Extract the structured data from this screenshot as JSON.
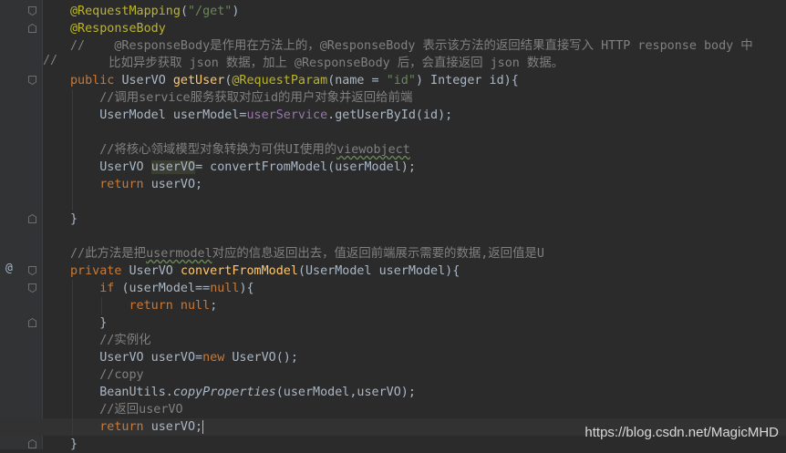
{
  "editor": {
    "lines": [
      {
        "tokens": [
          [
            "ann",
            "@RequestMapping"
          ],
          [
            "plain",
            "("
          ],
          [
            "str",
            "\"/get\""
          ],
          [
            "plain",
            ")"
          ]
        ]
      },
      {
        "tokens": [
          [
            "ann",
            "@ResponseBody"
          ]
        ]
      },
      {
        "tokens": [
          [
            "com",
            "//    @ResponseBody是作用在方法上的，@ResponseBody 表示该方法的返回结果直接写入 HTTP response body 中"
          ]
        ]
      },
      {
        "tokens": [
          [
            "com",
            "   比如异步获取 json 数据，加上 @ResponseBody 后，会直接返回 json 数据。"
          ]
        ]
      },
      {
        "tokens": [
          [
            "kw",
            "public "
          ],
          [
            "plain",
            "UserVO "
          ],
          [
            "fn",
            "getUser"
          ],
          [
            "plain",
            "("
          ],
          [
            "ann",
            "@RequestParam"
          ],
          [
            "plain",
            "(name = "
          ],
          [
            "str",
            "\"id\""
          ],
          [
            "plain",
            ") Integer id){"
          ]
        ]
      },
      {
        "tokens": [
          [
            "com",
            "    //调用service服务获取对应id的用户对象并返回给前端"
          ]
        ]
      },
      {
        "tokens": [
          [
            "plain",
            "    UserModel userModel="
          ],
          [
            "fld",
            "userService"
          ],
          [
            "plain",
            ".getUserById(id);"
          ]
        ]
      },
      {
        "tokens": [
          [
            "plain",
            ""
          ]
        ]
      },
      {
        "tokens": [
          [
            "com",
            "    //将核心领域模型对象转换为可供UI使用的"
          ],
          [
            "com squiggle",
            "viewobject"
          ]
        ]
      },
      {
        "tokens": [
          [
            "plain",
            "    UserVO "
          ],
          [
            "plain hl-var",
            "userVO"
          ],
          [
            "plain",
            "= convertFromModel(userModel);"
          ]
        ]
      },
      {
        "tokens": [
          [
            "kw",
            "    return "
          ],
          [
            "plain",
            "userVO;"
          ]
        ]
      },
      {
        "tokens": [
          [
            "plain",
            ""
          ]
        ]
      },
      {
        "tokens": [
          [
            "plain",
            "}"
          ]
        ]
      },
      {
        "tokens": [
          [
            "plain",
            ""
          ]
        ]
      },
      {
        "tokens": [
          [
            "com",
            "//此方法是把"
          ],
          [
            "com squiggle",
            "usermodel"
          ],
          [
            "com",
            "对应的信息返回出去，值返回前端展示需要的数据,返回值是U"
          ]
        ]
      },
      {
        "tokens": [
          [
            "kw",
            "private "
          ],
          [
            "plain",
            "UserVO "
          ],
          [
            "fn",
            "convertFromModel"
          ],
          [
            "plain",
            "(UserModel userModel){"
          ]
        ]
      },
      {
        "tokens": [
          [
            "kw",
            "    if "
          ],
          [
            "plain",
            "(userModel=="
          ],
          [
            "kw",
            "null"
          ],
          [
            "plain",
            "){"
          ]
        ]
      },
      {
        "tokens": [
          [
            "kw",
            "        return null"
          ],
          [
            "plain",
            ";"
          ]
        ]
      },
      {
        "tokens": [
          [
            "plain",
            "    }"
          ]
        ]
      },
      {
        "tokens": [
          [
            "com",
            "    //实例化"
          ]
        ]
      },
      {
        "tokens": [
          [
            "plain",
            "    UserVO userVO="
          ],
          [
            "kw",
            "new "
          ],
          [
            "plain",
            "UserVO();"
          ]
        ]
      },
      {
        "tokens": [
          [
            "com",
            "    //copy"
          ]
        ]
      },
      {
        "tokens": [
          [
            "plain",
            "    BeanUtils."
          ],
          [
            "plain ital",
            "copyProperties"
          ],
          [
            "plain",
            "(userModel,userVO);"
          ]
        ]
      },
      {
        "tokens": [
          [
            "com",
            "    //返回userVO"
          ]
        ]
      },
      {
        "tokens": [
          [
            "kw",
            "    return "
          ],
          [
            "plain",
            "userVO;"
          ]
        ]
      },
      {
        "tokens": [
          [
            "plain",
            "}"
          ]
        ]
      }
    ],
    "gutter": {
      "line_comment_marker": "//",
      "override_marker": "@"
    }
  },
  "watermark": "https://blog.csdn.net/MagicMHD"
}
